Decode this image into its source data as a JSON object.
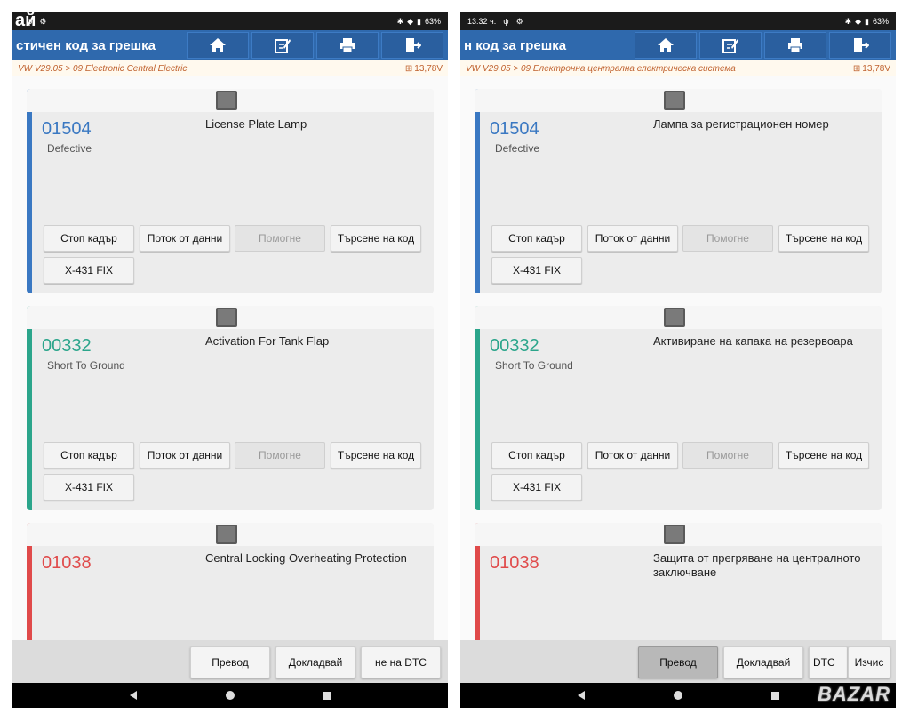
{
  "panels": {
    "left": {
      "status": {
        "time": "",
        "overlay": "ай",
        "battery": "63%"
      },
      "title": "стичен код за грешка",
      "breadcrumb": "VW V29.05 > 09 Electronic Central Electric",
      "voltage": "13,78V",
      "cards": [
        {
          "code": "01504",
          "status": "Defective",
          "description": "License Plate Lamp",
          "color": "#3a78c2"
        },
        {
          "code": "00332",
          "status": "Short To Ground",
          "description": "Activation For Tank Flap",
          "color": "#2ba58b"
        },
        {
          "code": "01038",
          "status": "",
          "description": "Central Locking Overheating Protection",
          "color": "#e04a4a"
        }
      ],
      "bottom": [
        "Превод",
        "Докладвай",
        "не на DTC"
      ]
    },
    "right": {
      "status": {
        "time": "13:32 ч.",
        "battery": "63%"
      },
      "title": "н код за грешка",
      "breadcrumb": "VW V29.05 > 09 Електронна централна електрическа система",
      "voltage": "13,78V",
      "cards": [
        {
          "code": "01504",
          "status": "Defective",
          "description": "Лампа за регистрационен номер",
          "color": "#3a78c2"
        },
        {
          "code": "00332",
          "status": "Short To Ground",
          "description": "Активиране на капака на резервоара",
          "color": "#2ba58b"
        },
        {
          "code": "01038",
          "status": "",
          "description": "Защита от прегряване на централното заключване",
          "color": "#e04a4a"
        }
      ],
      "bottom": [
        "Превод",
        "Докладвай",
        "DTC",
        "Изчис"
      ],
      "watermark": "BAZAR"
    }
  },
  "card_buttons": {
    "freeze": "Стоп кадър",
    "datastream": "Поток от данни",
    "help": "Помогне",
    "search": "Търсене на код",
    "fix": "X-431 FIX"
  },
  "toolbar_icons": [
    "home-icon",
    "report-edit-icon",
    "print-icon",
    "exit-icon"
  ],
  "theme": {
    "appbar": "#2f69ad",
    "breadcrumb_text": "#c0622f"
  }
}
